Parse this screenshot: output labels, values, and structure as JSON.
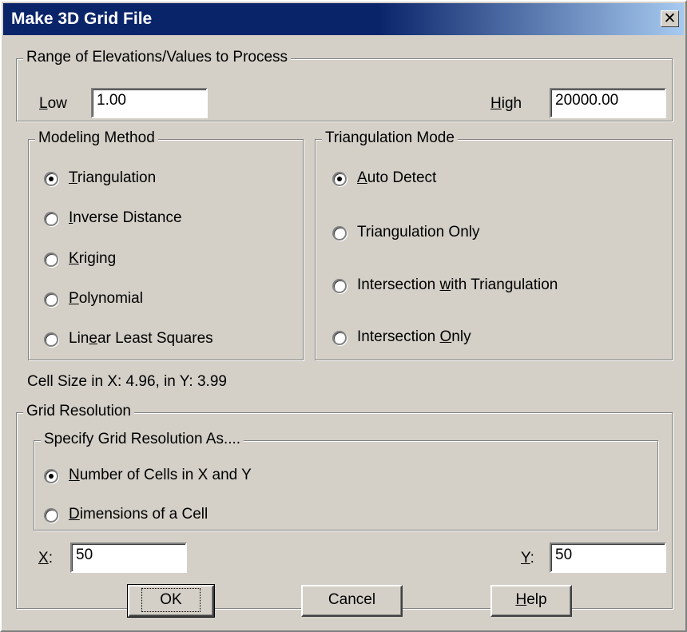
{
  "window": {
    "title": "Make 3D Grid File",
    "close_glyph": "✕"
  },
  "range": {
    "legend": "Range of Elevations/Values to Process",
    "low": {
      "pre": "",
      "ul": "L",
      "post": "ow",
      "value": "1.00"
    },
    "high": {
      "pre": "",
      "ul": "H",
      "post": "igh",
      "value": "20000.00"
    }
  },
  "modeling": {
    "legend": "Modeling Method",
    "options": [
      {
        "pre": "",
        "ul": "T",
        "post": "riangulation",
        "selected": true
      },
      {
        "pre": "",
        "ul": "I",
        "post": "nverse Distance",
        "selected": false
      },
      {
        "pre": "",
        "ul": "K",
        "post": "riging",
        "selected": false
      },
      {
        "pre": "",
        "ul": "P",
        "post": "olynomial",
        "selected": false
      },
      {
        "pre": "Lin",
        "ul": "e",
        "post": "ar Least Squares",
        "selected": false
      }
    ]
  },
  "triangulation": {
    "legend": "Triangulation Mode",
    "options": [
      {
        "pre": "",
        "ul": "A",
        "post": "uto Detect",
        "selected": true
      },
      {
        "pre": "Triangulation Only",
        "ul": "",
        "post": "",
        "selected": false
      },
      {
        "pre": "Intersection ",
        "ul": "w",
        "post": "ith Triangulation",
        "selected": false
      },
      {
        "pre": "Intersection ",
        "ul": "O",
        "post": "nly",
        "selected": false
      }
    ]
  },
  "cell_size_text": "Cell Size in X: 4.96, in Y: 3.99",
  "grid_resolution": {
    "legend": "Grid Resolution",
    "specify_legend": "Specify Grid Resolution As....",
    "options": [
      {
        "pre": "",
        "ul": "N",
        "post": "umber of Cells in X and Y",
        "selected": true
      },
      {
        "pre": "",
        "ul": "D",
        "post": "imensions of a Cell",
        "selected": false
      }
    ],
    "x": {
      "pre": "",
      "ul": "X",
      "post": ":",
      "value": "50"
    },
    "y": {
      "pre": "",
      "ul": "Y",
      "post": ":",
      "value": "50"
    }
  },
  "buttons": {
    "ok": "OK",
    "cancel": "Cancel",
    "help": {
      "pre": "",
      "ul": "H",
      "post": "elp"
    }
  }
}
